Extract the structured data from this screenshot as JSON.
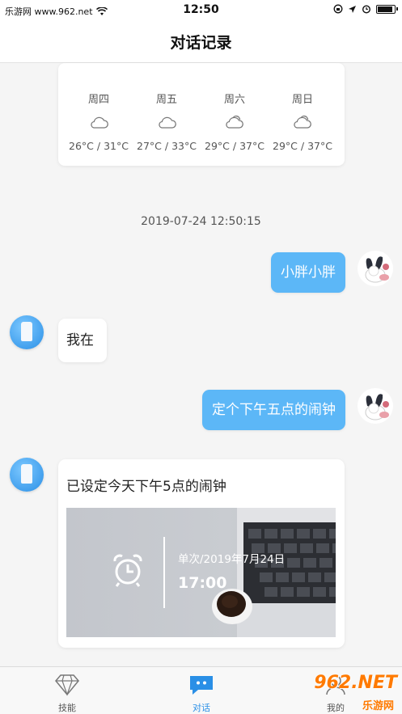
{
  "status_bar": {
    "carrier": "乐游网 www.962.net",
    "time": "12:50"
  },
  "header": {
    "title": "对话记录"
  },
  "weather": {
    "days": [
      {
        "day": "周四",
        "temp": "26°C / 31°C",
        "icon": "cloud-icon"
      },
      {
        "day": "周五",
        "temp": "27°C / 33°C",
        "icon": "cloud-icon"
      },
      {
        "day": "周六",
        "temp": "29°C / 37°C",
        "icon": "partly-cloudy-icon"
      },
      {
        "day": "周日",
        "temp": "29°C / 37°C",
        "icon": "partly-cloudy-icon"
      }
    ]
  },
  "chat": {
    "timestamp": "2019-07-24 12:50:15",
    "messages": [
      {
        "from": "user",
        "text": "小胖小胖"
      },
      {
        "from": "bot",
        "text": "我在"
      },
      {
        "from": "user",
        "text": "定个下午五点的闹钟"
      },
      {
        "from": "bot",
        "text": "已设定今天下午5点的闹钟"
      }
    ],
    "alarm": {
      "date": "单次/2019年7月24日",
      "time": "17:00"
    }
  },
  "tab_bar": {
    "tabs": [
      {
        "label": "技能",
        "icon": "diamond-icon",
        "active": false
      },
      {
        "label": "对话",
        "icon": "chat-icon",
        "active": true
      },
      {
        "label": "我的",
        "icon": "profile-icon",
        "active": false
      }
    ]
  },
  "watermark": {
    "logo": "962.NET",
    "sub": "乐游网"
  },
  "colors": {
    "accent": "#2a8fe6",
    "user_bubble": "#5cb7f7",
    "background": "#f5f5f5"
  }
}
